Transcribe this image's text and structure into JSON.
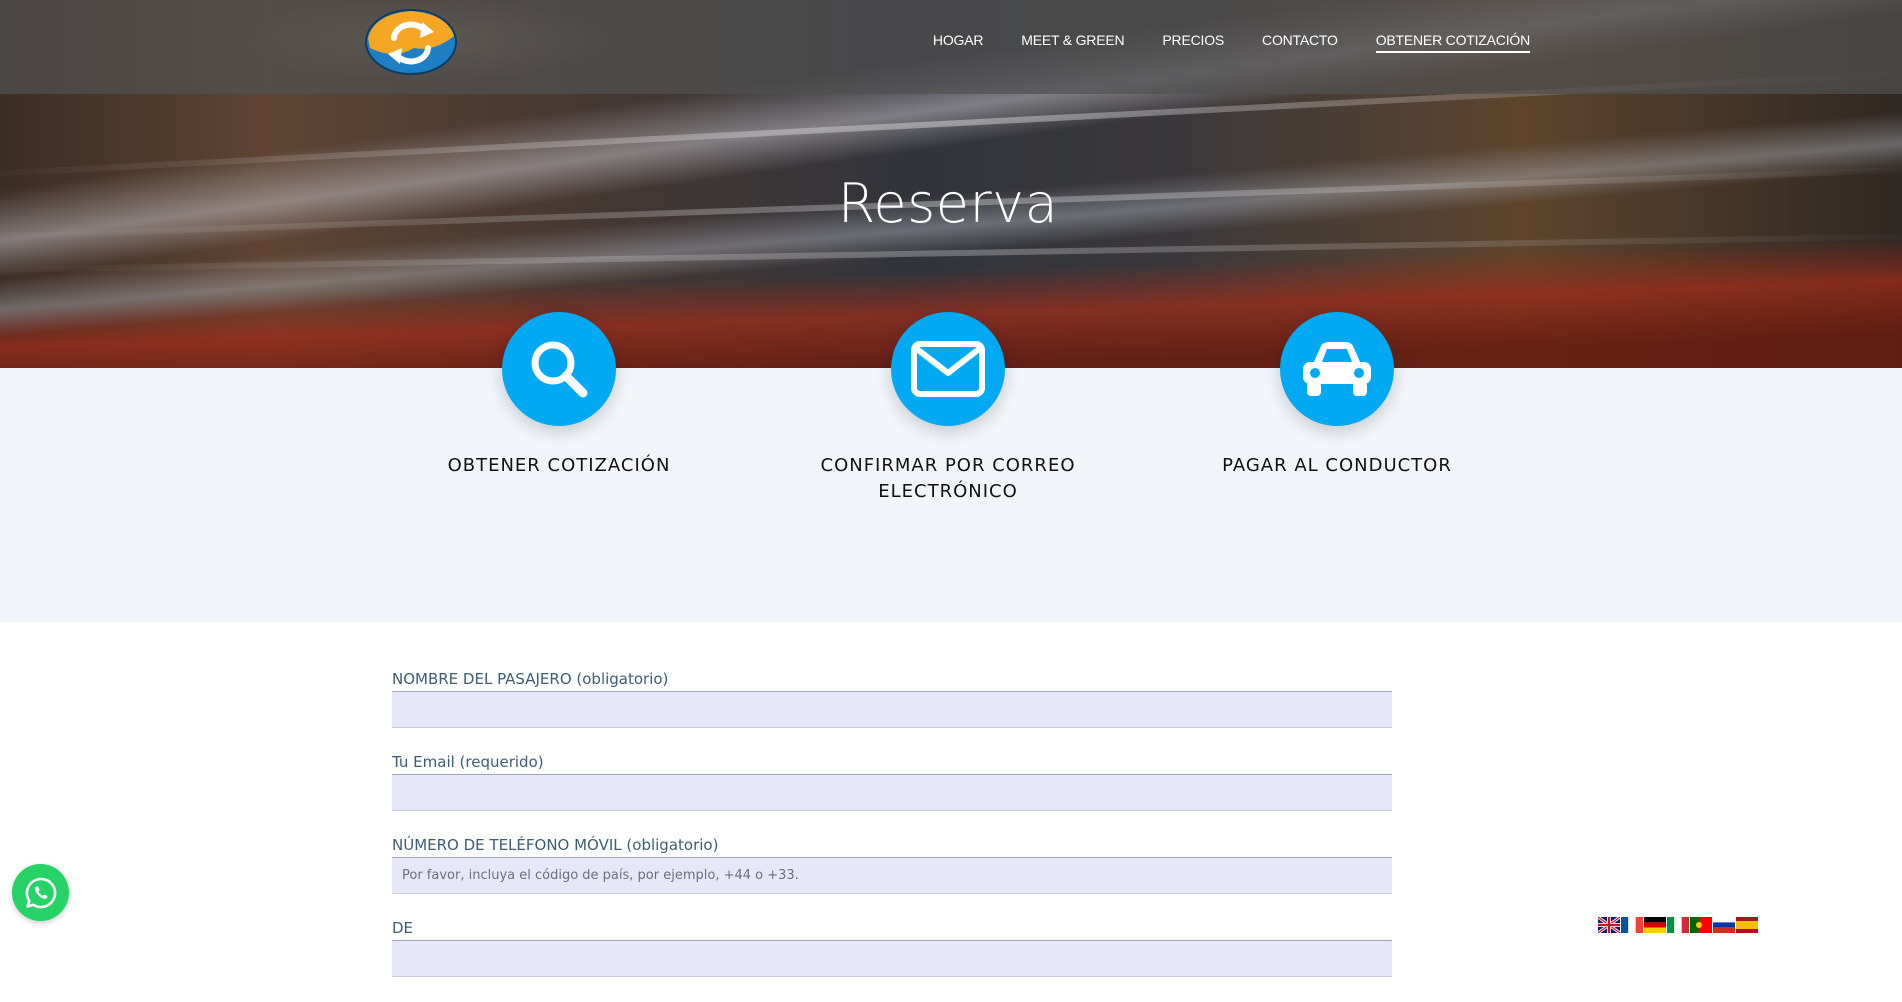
{
  "nav": {
    "items": [
      {
        "label": "HOGAR"
      },
      {
        "label": "MEET & GREEN"
      },
      {
        "label": "PRECIOS"
      },
      {
        "label": "CONTACTO"
      },
      {
        "label": "OBTENER COTIZACIÓN",
        "active": true
      }
    ]
  },
  "hero": {
    "title": "Reserva"
  },
  "steps": [
    {
      "icon": "search-icon",
      "label": "OBTENER COTIZACIÓN"
    },
    {
      "icon": "envelope-icon",
      "label": "CONFIRMAR POR CORREO ELECTRÓNICO"
    },
    {
      "icon": "car-icon",
      "label": "PAGAR AL CONDUCTOR"
    }
  ],
  "form": {
    "fields": [
      {
        "label": "NOMBRE DEL PASAJERO (obligatorio)",
        "placeholder": ""
      },
      {
        "label": "Tu Email (requerido)",
        "placeholder": ""
      },
      {
        "label": "NÚMERO DE TELÉFONO MÓVIL (obligatorio)",
        "placeholder": "Por favor, incluya el código de país, por ejemplo, +44 o +33."
      },
      {
        "label": "DE",
        "placeholder": ""
      }
    ]
  },
  "colors": {
    "accent": "#00a9f2",
    "whatsapp": "#25d366",
    "label": "#3e5d73",
    "input_bg": "#e6e8fa"
  },
  "flags": [
    "english-flag-icon",
    "french-flag-icon",
    "german-flag-icon",
    "italian-flag-icon",
    "portuguese-flag-icon",
    "russian-flag-icon",
    "spanish-flag-icon"
  ]
}
